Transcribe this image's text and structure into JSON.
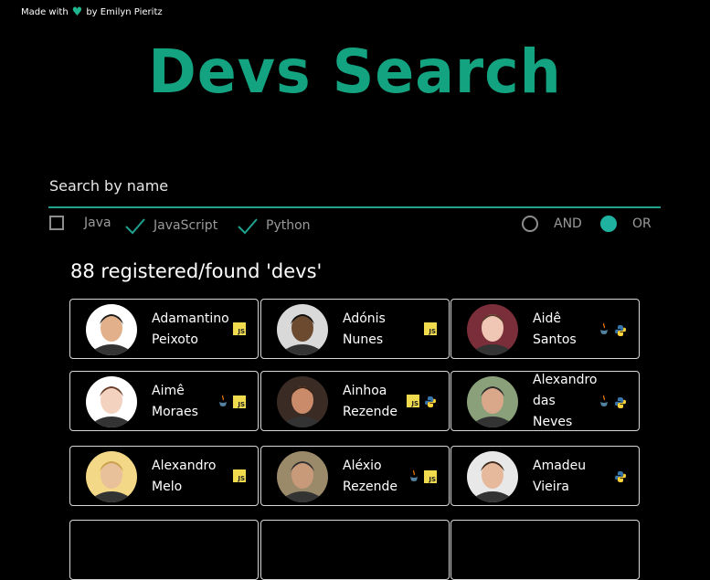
{
  "credit": {
    "prefix": "Made with",
    "suffix": "by Emilyn Pieritz"
  },
  "title": "Devs Search",
  "search": {
    "placeholder": "Search by name"
  },
  "filters": {
    "languages": [
      {
        "label": "Java",
        "checked": false
      },
      {
        "label": "JavaScript",
        "checked": true
      },
      {
        "label": "Python",
        "checked": true
      }
    ],
    "modes": [
      {
        "label": "AND",
        "selected": false
      },
      {
        "label": "OR",
        "selected": true
      }
    ]
  },
  "count_text": "88 registered/found 'devs'",
  "colors": {
    "accent": "#13a381",
    "underline": "#1fa38f",
    "radio_on": "#20b2a0"
  },
  "devs": [
    {
      "first": "Adamantino",
      "last": "Peixoto",
      "langs": [
        "js"
      ]
    },
    {
      "first": "Adónis",
      "last": "Nunes",
      "langs": [
        "js"
      ]
    },
    {
      "first": "Aidê",
      "last": "Santos",
      "langs": [
        "java",
        "python"
      ]
    },
    {
      "first": "Aimê",
      "last": "Moraes",
      "langs": [
        "java",
        "js"
      ]
    },
    {
      "first": "Ainhoa",
      "last": "Rezende",
      "langs": [
        "js",
        "python"
      ]
    },
    {
      "first": "Alexandro",
      "mid": "das",
      "last": "Neves",
      "langs": [
        "java",
        "python"
      ]
    },
    {
      "first": "Alexandro",
      "last": "Melo",
      "langs": [
        "js"
      ]
    },
    {
      "first": "Aléxio",
      "last": "Rezende",
      "langs": [
        "java",
        "js"
      ]
    },
    {
      "first": "Amadeu",
      "last": "Vieira",
      "langs": [
        "python"
      ]
    }
  ]
}
